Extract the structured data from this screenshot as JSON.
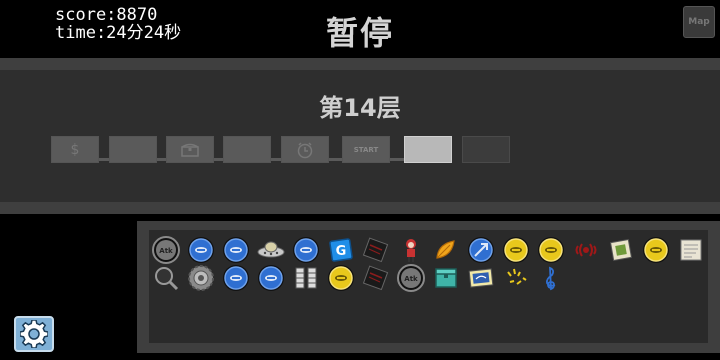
{
  "hud": {
    "score_line": "score:8870",
    "time_line": "time:24分24秒",
    "title": "暂停",
    "map_label": "Map"
  },
  "floor": {
    "label": "第14层",
    "rooms": [
      {
        "type": "shop",
        "icon": "dollar-icon",
        "glyph": "$",
        "state": "visited"
      },
      {
        "type": "normal",
        "icon": "",
        "glyph": "",
        "state": "visited"
      },
      {
        "type": "treasure",
        "icon": "chest-icon",
        "glyph": "",
        "state": "visited"
      },
      {
        "type": "normal",
        "icon": "",
        "glyph": "",
        "state": "visited"
      },
      {
        "type": "timer",
        "icon": "clock-icon",
        "glyph": "",
        "state": "visited"
      },
      {
        "type": "start",
        "icon": "",
        "glyph": "START",
        "state": "visited"
      },
      {
        "type": "current",
        "icon": "",
        "glyph": "",
        "state": "current"
      },
      {
        "type": "unexplored",
        "icon": "",
        "glyph": "",
        "state": "future"
      }
    ]
  },
  "inventory": {
    "row1": [
      "atk-coin-icon",
      "blue-coin-icon",
      "blue-coin-icon",
      "ufo-icon",
      "blue-coin-icon",
      "g-card-icon",
      "black-book-icon",
      "red-doll-icon",
      "orange-leaf-icon",
      "blue-clock-coin-icon",
      "yellow-coin-icon",
      "yellow-coin-icon",
      "red-swirl-icon",
      "green-photo-icon",
      "yellow-coin-icon",
      "paper-scroll-icon"
    ],
    "row2": [
      "magnifier-icon",
      "gear-coin-icon",
      "blue-coin-icon",
      "blue-coin-icon",
      "coin-stack-icon",
      "yellow-coin-icon",
      "black-book-icon",
      "atk-coin-icon",
      "teal-chest-icon",
      "blue-map-icon",
      "yellow-sparks-icon",
      "treble-clef-icon"
    ]
  },
  "colors": {
    "blue_coin": "#2f6fd1",
    "yellow_coin": "#e8c81c",
    "grey_coin": "#8a8a8a",
    "settings_bg": "#7fb0d6"
  }
}
